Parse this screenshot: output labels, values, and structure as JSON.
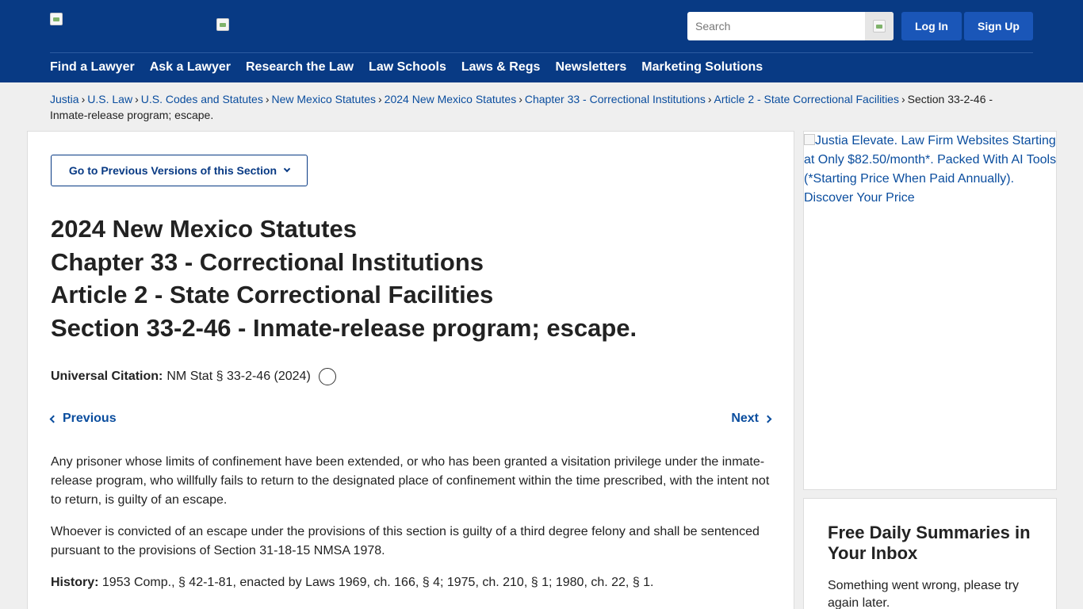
{
  "header": {
    "search_placeholder": "Search",
    "login_label": "Log In",
    "signup_label": "Sign Up",
    "nav": [
      "Find a Lawyer",
      "Ask a Lawyer",
      "Research the Law",
      "Law Schools",
      "Laws & Regs",
      "Newsletters",
      "Marketing Solutions"
    ]
  },
  "breadcrumb": {
    "links": [
      "Justia",
      "U.S. Law",
      "U.S. Codes and Statutes",
      "New Mexico Statutes",
      "2024 New Mexico Statutes",
      "Chapter 33 - Correctional Institutions",
      "Article 2 - State Correctional Facilities"
    ],
    "separator": "›",
    "current": "Section 33-2-46 - Inmate-release program; escape."
  },
  "main": {
    "versions_button": "Go to Previous Versions of this Section",
    "title_lines": [
      "2024 New Mexico Statutes",
      "Chapter 33 - Correctional Institutions",
      "Article 2 - State Correctional Facilities",
      "Section 33-2-46 - Inmate-release program; escape."
    ],
    "citation_label": "Universal Citation:",
    "citation_value": "NM Stat § 33-2-46 (2024)",
    "previous_label": "Previous",
    "next_label": "Next",
    "paragraphs": [
      "Any prisoner whose limits of confinement have been extended, or who has been granted a visitation privilege under the inmate-release program, who willfully fails to return to the designated place of confinement within the time prescribed, with the intent not to return, is guilty of an escape.",
      "Whoever is convicted of an escape under the provisions of this section is guilty of a third degree felony and shall be sentenced pursuant to the provisions of Section 31-18-15 NMSA 1978."
    ],
    "history_label": "History:",
    "history_value": "1953 Comp., § 42-1-81, enacted by Laws 1969, ch. 166, § 4; 1975, ch. 210, § 1; 1980, ch. 22, § 1."
  },
  "sidebar": {
    "ad_alt": "Justia Elevate. Law Firm Websites Starting at Only $82.50/month*. Packed With AI Tools (*Starting Price When Paid Annually). Discover Your Price",
    "newsletter_title": "Free Daily Summaries in Your Inbox",
    "newsletter_error": "Something went wrong, please try again later."
  },
  "colors": {
    "header_bg": "#083a84",
    "button_bg": "#1a56b8",
    "link": "#0a4d9e"
  }
}
